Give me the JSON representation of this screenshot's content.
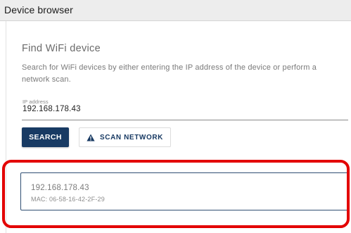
{
  "header": {
    "title": "Device browser"
  },
  "find_wifi": {
    "title": "Find WiFi device",
    "description": "Search for WiFi devices by either entering the IP address of the device or perform a network scan.",
    "ip_field": {
      "label": "IP address",
      "value": "192.168.178.43"
    },
    "search_button_label": "SEARCH",
    "scan_button": {
      "label": "SCAN NETWORK",
      "icon": "warning-triangle-icon"
    }
  },
  "results": [
    {
      "ip": "192.168.178.43",
      "mac": "MAC: 06-58-16-42-2F-29"
    }
  ],
  "colors": {
    "primary": "#183a63",
    "highlight": "#e30000",
    "header_bg": "#ededed"
  }
}
